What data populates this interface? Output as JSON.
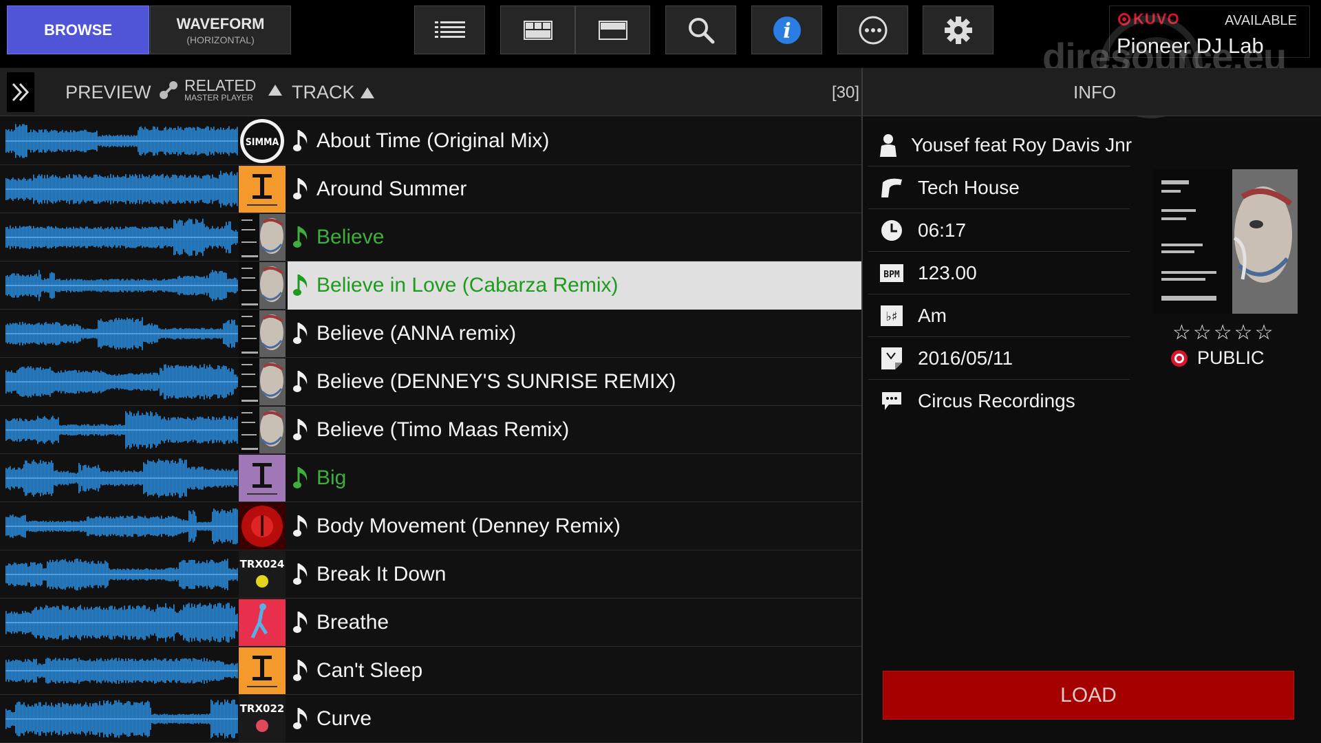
{
  "header": {
    "tabs": {
      "browse": "BROWSE",
      "waveform": "WAVEFORM",
      "waveform_sub": "(HORIZONTAL)"
    },
    "toolbar_icons": [
      "list-view-icon",
      "grid-view-icon",
      "split-view-icon",
      "search-icon",
      "info-icon",
      "more-icon",
      "gear-icon"
    ],
    "kuvo": {
      "logo": "KUVO",
      "status": "AVAILABLE",
      "name": "Pioneer DJ Lab"
    },
    "watermark": "djresource.eu"
  },
  "columns": {
    "preview": "PREVIEW",
    "related": "RELATED",
    "related_sub": "MASTER PLAYER",
    "track": "TRACK",
    "count": "[30]",
    "info": "INFO"
  },
  "tracks": [
    {
      "title": "About Time (Original Mix)",
      "art": "simma",
      "highlight": false,
      "selected": false
    },
    {
      "title": "Around Summer",
      "art": "orange-t",
      "highlight": false,
      "selected": false
    },
    {
      "title": "Believe",
      "art": "face",
      "highlight": true,
      "selected": false
    },
    {
      "title": "Believe in Love (Cabarza Remix)",
      "art": "face2",
      "highlight": true,
      "selected": true
    },
    {
      "title": "Believe (ANNA remix)",
      "art": "face",
      "highlight": false,
      "selected": false
    },
    {
      "title": "Believe (DENNEY'S SUNRISE REMIX)",
      "art": "face",
      "highlight": false,
      "selected": false
    },
    {
      "title": "Believe (Timo Maas Remix)",
      "art": "face",
      "highlight": false,
      "selected": false
    },
    {
      "title": "Big",
      "art": "purple-t",
      "highlight": true,
      "selected": false
    },
    {
      "title": "Body Movement (Denney Remix)",
      "art": "red",
      "highlight": false,
      "selected": false
    },
    {
      "title": "Break It Down",
      "art": "trx024",
      "highlight": false,
      "selected": false
    },
    {
      "title": "Breathe",
      "art": "pink",
      "highlight": false,
      "selected": false
    },
    {
      "title": "Can't Sleep",
      "art": "orange-t",
      "highlight": false,
      "selected": false
    },
    {
      "title": "Curve",
      "art": "trx022",
      "highlight": false,
      "selected": false
    }
  ],
  "art_labels": {
    "simma": "SIMMA",
    "trx024": "TRX024",
    "trx022": "TRX022"
  },
  "info": {
    "artist": "Yousef feat Roy Davis Jnr",
    "genre": "Tech House",
    "time": "06:17",
    "bpm_icon_label": "BPM",
    "bpm": "123.00",
    "key": "Am",
    "date": "2016/05/11",
    "label": "Circus Recordings",
    "rating_stars": "☆☆☆☆☆",
    "visibility": "PUBLIC"
  },
  "load_label": "LOAD",
  "colors": {
    "browse_tab": "#4f55d6",
    "waveform": "#2a8ee0",
    "highlight_text": "#3fae3f",
    "load": "#a50000",
    "kuvo_red": "#d8132a"
  }
}
